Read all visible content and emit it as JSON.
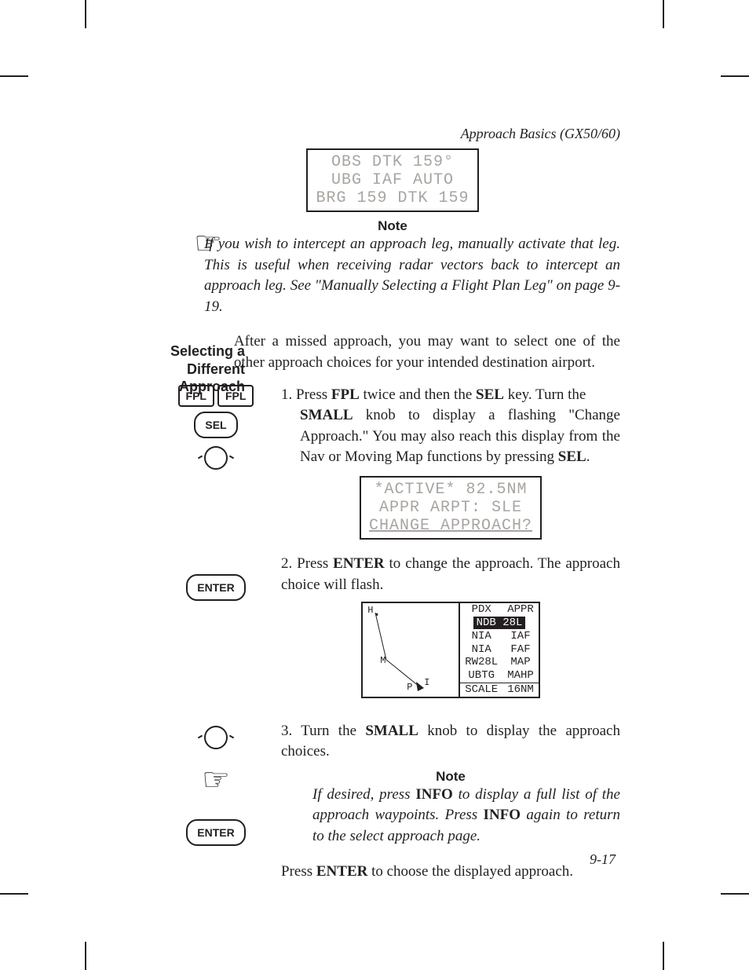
{
  "header": "Approach Basics (GX50/60)",
  "lcd1": {
    "l1": "OBS DTK  159°",
    "l2": "UBG  IAF     AUTO",
    "l3": "BRG 159   DTK 159"
  },
  "note_hdr": "Note",
  "note1": "If you wish to intercept an approach leg, manually activate that leg. This is useful when receiving radar vectors back to intercept an approach leg. See \"Manually Selecting a Flight Plan Leg\" on page 9-19.",
  "sidehead": "Selecting a Different Approach",
  "intro": "After a missed approach, you may want to select one of the other approach choices for your intended destination airport.",
  "keys": {
    "fpl": "FPL",
    "sel": "SEL",
    "enter": "ENTER"
  },
  "step1_a": "1. Press ",
  "step1_b": " twice and then the ",
  "step1_c": " key. Turn the ",
  "step1_d": " knob to display a flashing \"Change Approach.\" You may also reach this display from the Nav or Moving Map functions by pressing ",
  "bold": {
    "fpl": "FPL",
    "sel": "SEL",
    "small": "SMALL",
    "enter": "ENTER",
    "info": "INFO"
  },
  "lcd2": {
    "l1": "*ACTIVE* 82.5NM",
    "l2": "APPR ARPT: SLE",
    "l3": "CHANGE APPROACH?"
  },
  "step2_a": "2. Press ",
  "step2_b": " to change the approach. The approach choice will flash.",
  "map": {
    "H": "H",
    "M": "M",
    "P": "P",
    "I": "I",
    "hdr1": "PDX",
    "hdr2": "APPR",
    "r1": "NDB 28L",
    "r2a": "NIA",
    "r2b": "IAF",
    "r3a": "NIA",
    "r3b": "FAF",
    "r4a": "RW28L",
    "r4b": "MAP",
    "r5a": "UBTG",
    "r5b": "MAHP",
    "r6a": "SCALE",
    "r6b": "16NM"
  },
  "step3_a": "3. Turn the ",
  "step3_b": " knob to display the approach choices.",
  "note2": "If desired, press INFO to display a full list of the approach waypoints. Press INFO again to return to the select approach page.",
  "note2_a": "If desired, press ",
  "note2_b": " to display a full list of the approach waypoints. Press ",
  "note2_c": " again to return to the select approach page.",
  "final_a": "Press ",
  "final_b": " to choose the displayed approach.",
  "pagenum": "9-17"
}
